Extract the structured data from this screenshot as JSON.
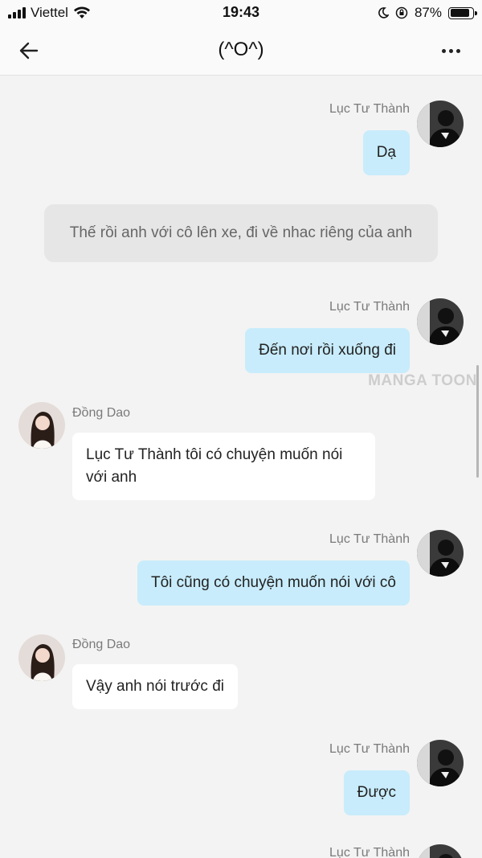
{
  "status_bar": {
    "carrier": "Viettel",
    "time": "19:43",
    "battery": "87%",
    "battery_level": 0.87
  },
  "nav": {
    "title": "(^O^)",
    "back_icon": "arrow-left-icon",
    "more_icon": "more-horizontal-icon"
  },
  "watermark": "MANGA TOON",
  "messages": [
    {
      "type": "right",
      "sender": "Lục Tư Thành",
      "text": "Dạ"
    },
    {
      "type": "narration",
      "text": "Thế rồi anh với cô lên xe, đi về nhac riêng của anh"
    },
    {
      "type": "right",
      "sender": "Lục Tư Thành",
      "text": "Đến nơi rồi xuống đi"
    },
    {
      "type": "left",
      "sender": "Đồng Dao",
      "text": "Lục Tư Thành tôi có chuyện muốn nói với anh"
    },
    {
      "type": "right",
      "sender": "Lục Tư Thành",
      "text": "Tôi cũng có chuyện muốn nói với cô"
    },
    {
      "type": "left",
      "sender": "Đồng Dao",
      "text": "Vậy anh nói trước đi"
    },
    {
      "type": "right",
      "sender": "Lục Tư Thành",
      "text": "Được"
    },
    {
      "type": "right",
      "sender": "Lục Tư Thành",
      "text": ""
    }
  ]
}
